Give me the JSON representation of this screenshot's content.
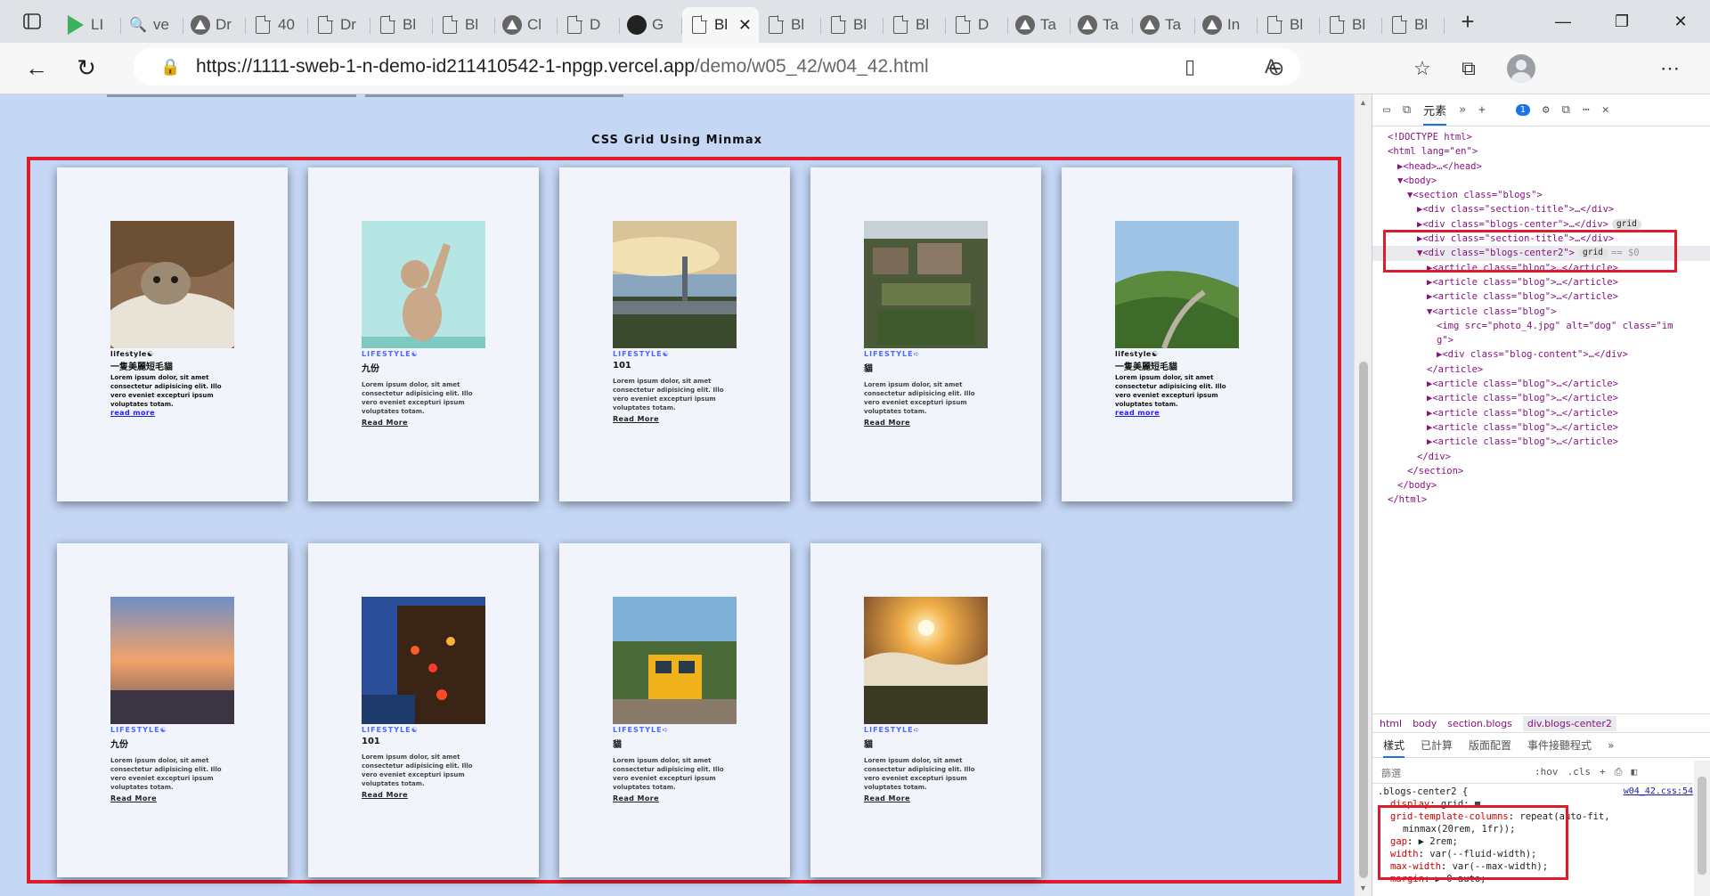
{
  "browser": {
    "tabs": [
      {
        "label": "LI",
        "icon": "play-icon"
      },
      {
        "label": "ve",
        "icon": "search-icon"
      },
      {
        "label": "Dr",
        "icon": "triangle-icon"
      },
      {
        "label": "40",
        "icon": "doc-icon"
      },
      {
        "label": "Dr",
        "icon": "doc-icon"
      },
      {
        "label": "Bl",
        "icon": "doc-icon"
      },
      {
        "label": "Bl",
        "icon": "doc-icon"
      },
      {
        "label": "Cl",
        "icon": "triangle-icon"
      },
      {
        "label": "D",
        "icon": "doc-icon"
      },
      {
        "label": "G",
        "icon": "github-icon"
      },
      {
        "label": "Bl",
        "icon": "doc-icon",
        "active": true
      },
      {
        "label": "Bl",
        "icon": "doc-icon"
      },
      {
        "label": "Bl",
        "icon": "doc-icon"
      },
      {
        "label": "Bl",
        "icon": "doc-icon"
      },
      {
        "label": "D",
        "icon": "doc-icon"
      },
      {
        "label": "Ta",
        "icon": "triangle-icon"
      },
      {
        "label": "Ta",
        "icon": "triangle-icon"
      },
      {
        "label": "Ta",
        "icon": "triangle-icon"
      },
      {
        "label": "In",
        "icon": "triangle-icon"
      },
      {
        "label": "Bl",
        "icon": "doc-icon"
      },
      {
        "label": "Bl",
        "icon": "doc-icon"
      },
      {
        "label": "Bl",
        "icon": "doc-icon"
      }
    ],
    "new_tab_label": "+",
    "close_tab_label": "✕",
    "window": {
      "minimize": "—",
      "restore": "❐",
      "close": "✕"
    },
    "url_host": "https://1111-sweb-1-n-demo-id211410542-1-npgp.vercel.app",
    "url_path": "/demo/w05_42/w04_42.html",
    "toolbar_glyphs": {
      "back": "←",
      "reload": "↻",
      "read_aloud": "A",
      "immersive": "▯",
      "zoom": "⊖",
      "favorite_add": "☆",
      "favorites": "☆",
      "collections": "⧉",
      "more": "⋯",
      "tab_actions": "▭",
      "lock": "🔒"
    }
  },
  "page": {
    "section_title": "CSS Grid Using Minmax",
    "blogs": [
      {
        "category": "lifestyle☯",
        "title": "一隻美麗短毛貓",
        "text": "Lorem ipsum dolor, sit amet consectetur adipisicing elit. Illo vero eveniet excepturi ipsum voluptates totam.",
        "link": "read more",
        "style": "plain",
        "image": "cat-blanket"
      },
      {
        "category": "LIFESTYLE☯",
        "title": "九份",
        "text": "Lorem ipsum dolor, sit amet consectetur adipisicing elit. Illo vero eveniet excepturi ipsum voluptates totam.",
        "link": "Read More",
        "style": "upper",
        "image": "kitten-paw"
      },
      {
        "category": "LIFESTYLE☯",
        "title": "101",
        "text": "Lorem ipsum dolor, sit amet consectetur adipisicing elit. Illo vero eveniet excepturi ipsum voluptates totam.",
        "link": "Read More",
        "style": "upper",
        "image": "taipei-skyline"
      },
      {
        "category": "LIFESTYLE➪",
        "title": "貓",
        "text": "Lorem ipsum dolor, sit amet consectetur adipisicing elit. Illo vero eveniet excepturi ipsum voluptates totam.",
        "link": "Read More",
        "style": "upper",
        "image": "jiufen-houses"
      },
      {
        "category": "lifestyle☯",
        "title": "一隻美麗短毛貓",
        "text": "Lorem ipsum dolor, sit amet consectetur adipisicing elit. Illo vero eveniet excepturi ipsum voluptates totam.",
        "link": "read more",
        "style": "plain",
        "image": "green-ridge"
      },
      {
        "category": "LIFESTYLE☯",
        "title": "九份",
        "text": "Lorem ipsum dolor, sit amet consectetur adipisicing elit. Illo vero eveniet excepturi ipsum voluptates totam.",
        "link": "Read More",
        "style": "upper",
        "image": "sunset-city"
      },
      {
        "category": "LIFESTYLE☯",
        "title": "101",
        "text": "Lorem ipsum dolor, sit amet consectetur adipisicing elit. Illo vero eveniet excepturi ipsum voluptates totam.",
        "link": "Read More",
        "style": "upper",
        "image": "jiufen-night"
      },
      {
        "category": "LIFESTYLE➪",
        "title": "貓",
        "text": "Lorem ipsum dolor, sit amet consectetur adipisicing elit. Illo vero eveniet excepturi ipsum voluptates totam.",
        "link": "Read More",
        "style": "upper",
        "image": "train-street"
      },
      {
        "category": "LIFESTYLE➪",
        "title": "貓",
        "text": "Lorem ipsum dolor, sit amet consectetur adipisicing elit. Illo vero eveniet excepturi ipsum voluptates totam.",
        "link": "Read More",
        "style": "upper",
        "image": "sea-of-clouds"
      }
    ]
  },
  "devtools": {
    "tabs": {
      "elements": "元素",
      "more": "»",
      "add": "+",
      "issues_count": "1"
    },
    "dom": [
      "<!DOCTYPE html>",
      "<html lang=\"en\">",
      "▶<head>…</head>",
      "▼<body>",
      "▼<section class=\"blogs\">",
      "▶<div class=\"section-title\">…</div>",
      "▶<div class=\"blogs-center\">…</div>",
      "▶<div class=\"section-title\">…</div>",
      "▼<div class=\"blogs-center2\">",
      "▶<article class=\"blog\">…</article>",
      "▶<article class=\"blog\">…</article>",
      "▶<article class=\"blog\">…</article>",
      "▼<article class=\"blog\">",
      "<img src=\"photo_4.jpg\" alt=\"dog\" class=\"im",
      "g\">",
      "▶<div class=\"blog-content\">…</div>",
      "</article>",
      "▶<article class=\"blog\">…</article>",
      "▶<article class=\"blog\">…</article>",
      "▶<article class=\"blog\">…</article>",
      "▶<article class=\"blog\">…</article>",
      "▶<article class=\"blog\">…</article>",
      "</div>",
      "</section>",
      "</body>",
      "</html>"
    ],
    "grid_pill": "grid",
    "sel_marker": "== $0",
    "crumbs": [
      "html",
      "body",
      "section.blogs",
      "div.blogs-center2"
    ],
    "sub_tabs": [
      "樣式",
      "已計算",
      "版面配置",
      "事件接聽程式",
      "»"
    ],
    "filter_placeholder": "篩選",
    "hov": ":hov",
    "cls": ".cls",
    "rule_selector": ".blogs-center2 {",
    "rule_source": "w04_42.css:54",
    "decls": [
      {
        "prop": "display",
        "val": "grid; ▦"
      },
      {
        "prop": "grid-template-columns",
        "val": "repeat(auto-fit,"
      },
      {
        "prop": "",
        "val": "minmax(20rem, 1fr));"
      },
      {
        "prop": "gap",
        "val": "▶ 2rem;"
      },
      {
        "prop": "width",
        "val": "var(--fluid-width);"
      },
      {
        "prop": "max-width",
        "val": "var(--max-width);"
      },
      {
        "prop": "margin",
        "val": "▶ 0 auto;"
      }
    ]
  },
  "colors": {
    "page_bg": "#c5d7f5",
    "highlight": "#e01b2b",
    "card_bg": "#f1f5fb",
    "category_blue": "#4f66ff",
    "link_blue": "#2319ff"
  }
}
